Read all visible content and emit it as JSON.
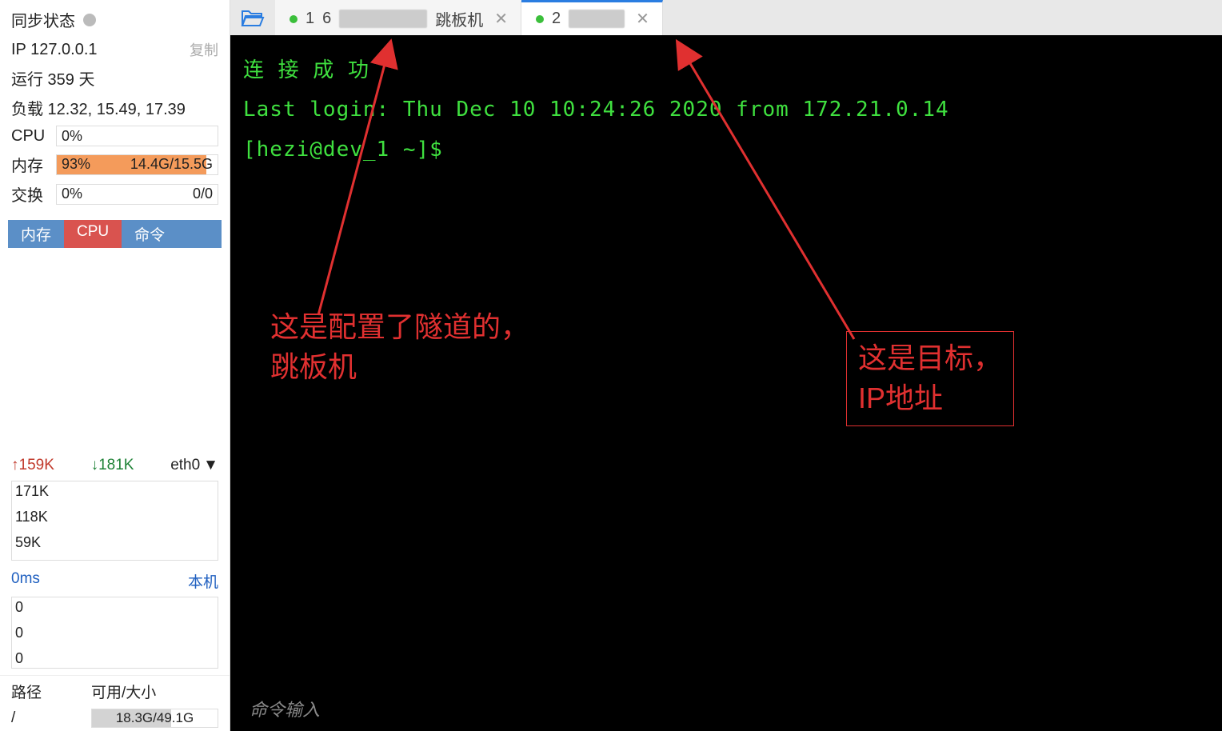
{
  "sidebar": {
    "sync_status_label": "同步状态",
    "ip_label": "IP 127.0.0.1",
    "copy_label": "复制",
    "uptime": "运行 359 天",
    "load": "负载 12.32, 15.49, 17.39",
    "cpu": {
      "label": "CPU",
      "pct": "0%",
      "fill": 0
    },
    "mem": {
      "label": "内存",
      "pct": "93%",
      "detail": "14.4G/15.5G",
      "fill": 93
    },
    "swap": {
      "label": "交换",
      "pct": "0%",
      "detail": "0/0",
      "fill": 0
    },
    "proc_tabs": {
      "mem": "内存",
      "cpu": "CPU",
      "cmd": "命令"
    },
    "net": {
      "up": "159K",
      "down": "181K",
      "iface": "eth0"
    },
    "net_chart_ticks": {
      "y1": "171K",
      "y2": "118K",
      "y3": "59K"
    },
    "ping": {
      "label": "0ms",
      "target": "本机"
    },
    "ping_ticks": {
      "t1": "0",
      "t2": "0",
      "t3": "0"
    },
    "disk": {
      "col_path": "路径",
      "col_avail": "可用/大小",
      "root_path": "/",
      "root_avail": "18.3G/49.1G",
      "root_fill": 63
    }
  },
  "tabs": {
    "tab1": {
      "index": "1",
      "prefix": "6",
      "suffix": "跳板机"
    },
    "tab2": {
      "index": "2"
    }
  },
  "terminal": {
    "line1": "连 接 成 功",
    "line2": "Last login: Thu Dec 10 10:24:26 2020 from 172.21.0.14",
    "line3": "[hezi@dev_1 ~]$"
  },
  "annotations": {
    "left": "这是配置了隧道的，\n跳板机",
    "right": "这是目标，\nIP地址"
  },
  "input_hint": "命令输入"
}
